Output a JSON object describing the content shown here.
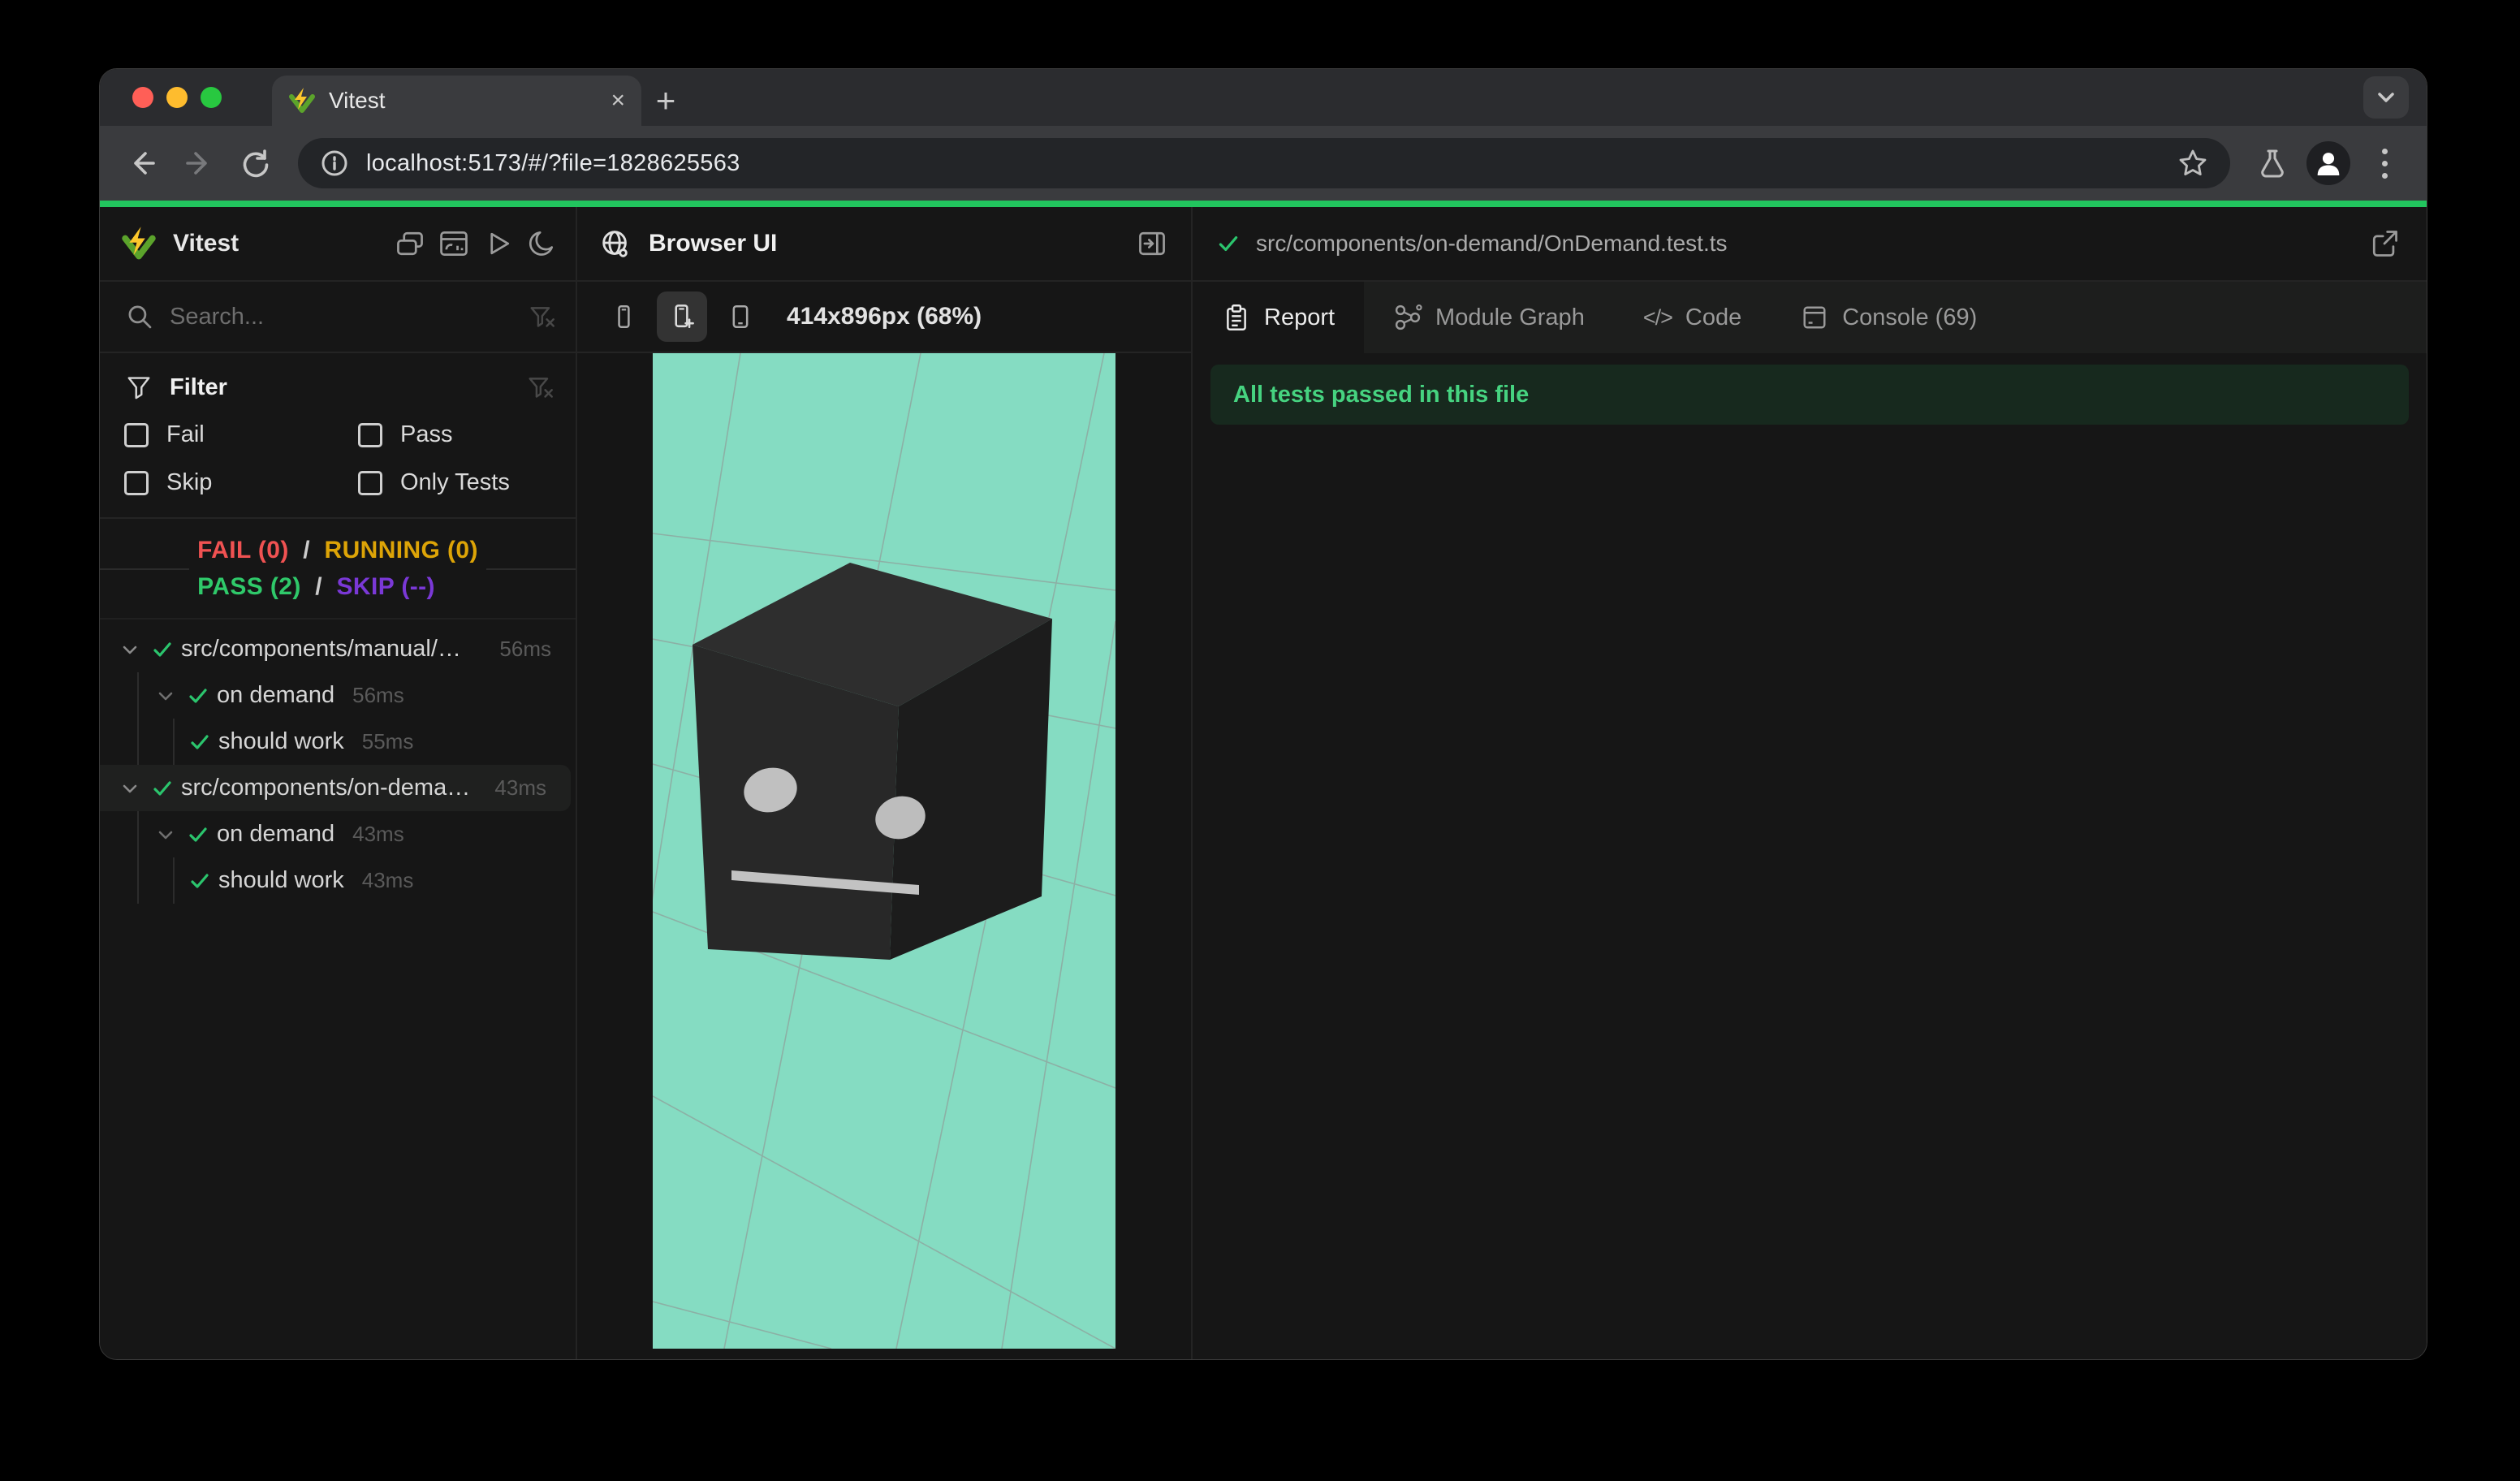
{
  "browser": {
    "tab_title": "Vitest",
    "url": "localhost:5173/#/?file=1828625563",
    "close_tab_glyph": "×",
    "new_tab_glyph": "+"
  },
  "sidebar": {
    "app_name": "Vitest",
    "search_placeholder": "Search...",
    "toolbar_icons": [
      "cascade-windows-icon",
      "dashboard-icon",
      "run-all-icon",
      "dark-mode-moon-icon"
    ],
    "filter": {
      "title": "Filter",
      "options": [
        {
          "label": "Fail",
          "checked": false
        },
        {
          "label": "Pass",
          "checked": false
        },
        {
          "label": "Skip",
          "checked": false
        },
        {
          "label": "Only Tests",
          "checked": false
        }
      ]
    },
    "summary": {
      "fail": "FAIL (0)",
      "running": "RUNNING (0)",
      "pass": "PASS (2)",
      "skip": "SKIP (--)",
      "separator": "/"
    },
    "tree": [
      {
        "level": 0,
        "type": "file",
        "status": "pass",
        "label": "src/components/manual/…",
        "time": "56ms",
        "selected": false
      },
      {
        "level": 1,
        "type": "suite",
        "status": "pass",
        "label": "on demand",
        "time": "56ms",
        "selected": false
      },
      {
        "level": 2,
        "type": "test",
        "status": "pass",
        "label": "should work",
        "time": "55ms",
        "selected": false
      },
      {
        "level": 0,
        "type": "file",
        "status": "pass",
        "label": "src/components/on-dema…",
        "time": "43ms",
        "selected": true
      },
      {
        "level": 1,
        "type": "suite",
        "status": "pass",
        "label": "on demand",
        "time": "43ms",
        "selected": false
      },
      {
        "level": 2,
        "type": "test",
        "status": "pass",
        "label": "should work",
        "time": "43ms",
        "selected": false
      }
    ]
  },
  "middle": {
    "title": "Browser UI",
    "device_buttons": [
      "phone-small-icon",
      "phone-plus-icon",
      "tablet-icon"
    ],
    "active_device_index": 1,
    "size_label": "414x896px (68%)"
  },
  "rightpanel": {
    "file_status": "pass",
    "file_path": "src/components/on-demand/OnDemand.test.ts",
    "tabs": [
      {
        "label": "Report",
        "icon": "report-clipboard-icon",
        "active": true
      },
      {
        "label": "Module Graph",
        "icon": "module-graph-icon",
        "active": false
      },
      {
        "label": "Code",
        "icon": "code-icon",
        "active": false
      },
      {
        "label": "Console (69)",
        "icon": "console-icon",
        "active": false
      }
    ],
    "banner": "All tests passed in this file"
  },
  "colors": {
    "fail_red": "#f05252",
    "running_yellow": "#dda407",
    "pass_green": "#2fc96a",
    "skip_purple": "#7a38d6",
    "progress_bar": "#22c55e",
    "check_green": "#2bc56d",
    "viewport_bg": "#85dcc2",
    "grid_line": "#8f9e99",
    "banner_bg": "#17291e",
    "banner_text": "#46d380"
  }
}
